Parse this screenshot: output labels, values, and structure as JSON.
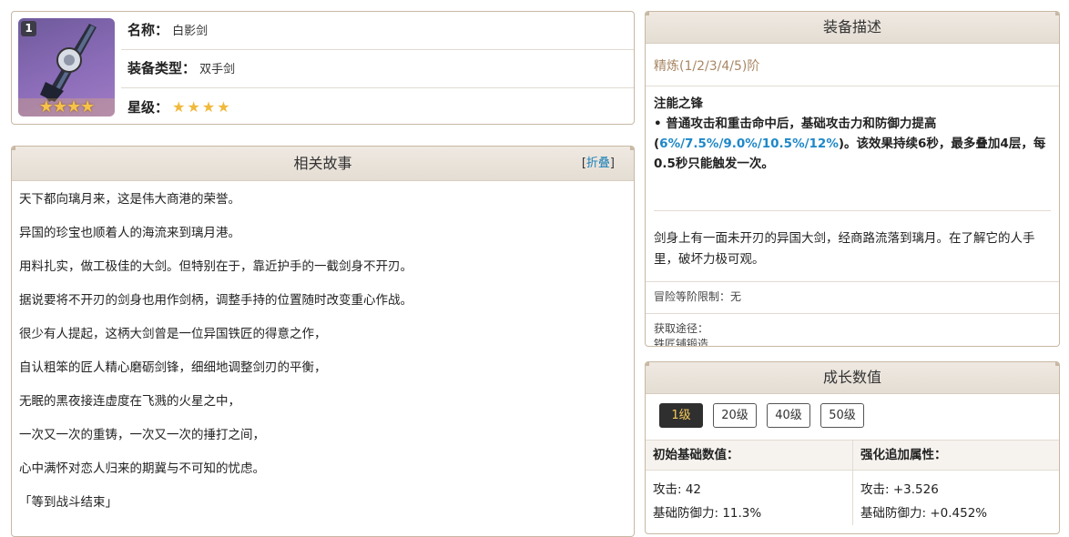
{
  "info": {
    "badge": "1",
    "rows": [
      {
        "key": "名称：",
        "value": "白影剑"
      },
      {
        "key": "装备类型：",
        "value": "双手剑"
      },
      {
        "key": "星级：",
        "value": ""
      }
    ],
    "rarity_stars": 4
  },
  "story": {
    "title": "相关故事",
    "fold_label": "折叠",
    "lines": [
      "天下都向璃月来，这是伟大商港的荣誉。",
      "异国的珍宝也顺着人的海流来到璃月港。",
      "用料扎实，做工极佳的大剑。但特别在于，靠近护手的一截剑身不开刃。",
      "据说要将不开刃的剑身也用作剑柄，调整手持的位置随时改变重心作战。",
      "很少有人提起，这柄大剑曾是一位异国铁匠的得意之作，",
      "自认粗笨的匠人精心磨砺剑锋，细细地调整剑刃的平衡，",
      "无眠的黑夜接连虚度在飞溅的火星之中，",
      "一次又一次的重铸，一次又一次的捶打之间，",
      "心中满怀对恋人归来的期冀与不可知的忧虑。",
      "「等到战斗结束」"
    ]
  },
  "desc": {
    "title": "装备描述",
    "refine": "精炼(1/2/3/4/5)阶",
    "skill_name": "注能之锋",
    "skill_text_1": "• 普通攻击和重击命中后，基础攻击力和防御力提高(",
    "skill_highlight": "6%/7.5%/9.0%/10.5%/12%",
    "skill_text_2": ")。该效果持续6秒，最多叠加4层，每0.5秒只能触发一次。",
    "flavor": "剑身上有一面未开刃的异国大剑，经商路流落到璃月。在了解它的人手里，破坏力极可观。",
    "adventure_limit": "冒险等阶限制：无",
    "source_label": "获取途径：",
    "source_value": "铁匠铺锻造"
  },
  "growth": {
    "title": "成长数值",
    "levels": [
      "1级",
      "20级",
      "40级",
      "50级"
    ],
    "active_level": 0,
    "base_head": "初始基础数值：",
    "bonus_head": "强化追加属性：",
    "base_stats": [
      "攻击: 42",
      "基础防御力: 11.3%"
    ],
    "bonus_stats": [
      "攻击: +3.526",
      "基础防御力: +0.452%"
    ]
  },
  "colors": {
    "accent_blue": "#1e88c8",
    "refine_brown": "#a88764",
    "border": "#c7b8a3",
    "active_tab_bg": "#2f2f2f",
    "active_tab_text": "#f4c95b"
  }
}
